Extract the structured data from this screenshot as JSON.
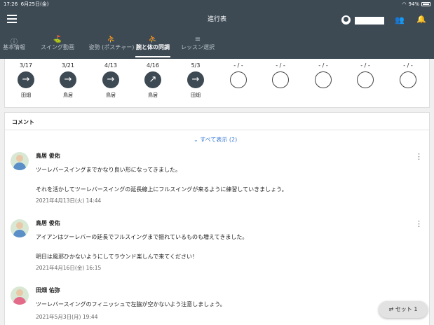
{
  "status": {
    "time": "17:26",
    "date": "6月25日(金)",
    "battery": "94%"
  },
  "header": {
    "title": "進行表"
  },
  "tabs": [
    {
      "label": "基本情報",
      "icon": "info-icon"
    },
    {
      "label": "スイング動画",
      "icon": "golfer-icon"
    },
    {
      "label": "姿勢 (ポスチャー)",
      "icon": "posture-icon"
    },
    {
      "label": "腕と体の同調",
      "icon": "arm-body-sync-icon"
    },
    {
      "label": "レッスン選択",
      "icon": "list-icon"
    }
  ],
  "steps": [
    {
      "date": "3/17",
      "person": "田畑",
      "arrow": "→"
    },
    {
      "date": "3/21",
      "person": "鳥居",
      "arrow": "→"
    },
    {
      "date": "4/13",
      "person": "鳥居",
      "arrow": "→"
    },
    {
      "date": "4/16",
      "person": "鳥居",
      "arrow": "↗"
    },
    {
      "date": "5/3",
      "person": "田畑",
      "arrow": "→"
    },
    {
      "date": "- / -",
      "person": "",
      "arrow": ""
    },
    {
      "date": "- / -",
      "person": "",
      "arrow": ""
    },
    {
      "date": "- / -",
      "person": "",
      "arrow": ""
    },
    {
      "date": "- / -",
      "person": "",
      "arrow": ""
    },
    {
      "date": "- / -",
      "person": "",
      "arrow": ""
    }
  ],
  "comments_section": {
    "title": "コメント",
    "show_all": "⌄ すべて表示 (2)",
    "comments": [
      {
        "name": "鳥居 俊佑",
        "lines": [
          "ツーレバースイングまでかなり良い形になってきました。",
          "それを活かしてツーレバースイングの延長線上にフルスイングが来るように練習していきましょう。"
        ],
        "date": "2021年4月13日(火) 14:44"
      },
      {
        "name": "鳥居 俊佑",
        "lines": [
          "アイアンはツーレバーの延長でフルスイングまで振れているものも増えてきました。",
          "明日は風邪ひかないようにしてラウンド楽しんで来てください！"
        ],
        "date": "2021年4月16日(金) 16:15"
      },
      {
        "name": "田畑 佑弥",
        "lines": [
          "ツーレバースイングのフィニッシュで左脇が空かないよう注意しましょう。"
        ],
        "date": "2021年5月3日(月) 19:44"
      }
    ]
  },
  "set_button": {
    "label": "セット 1"
  }
}
